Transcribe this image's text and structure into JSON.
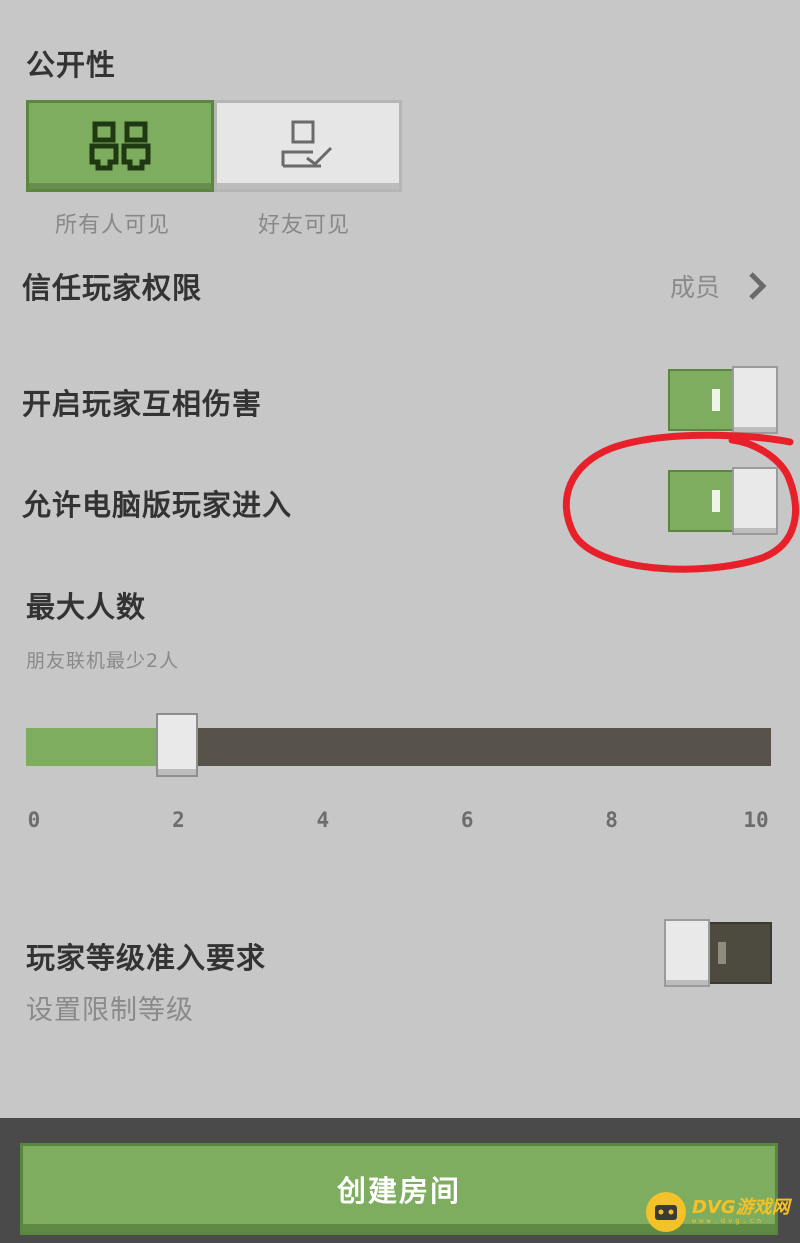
{
  "visibility": {
    "title": "公开性",
    "options": [
      {
        "label": "所有人可见",
        "icon": "all-players-icon",
        "selected": true
      },
      {
        "label": "好友可见",
        "icon": "friend-check-icon",
        "selected": false
      }
    ]
  },
  "trusted_permissions": {
    "label": "信任玩家权限",
    "value": "成员",
    "icon": "chevron-right-icon"
  },
  "pvp": {
    "label": "开启玩家互相伤害",
    "on": true
  },
  "pc_players": {
    "label": "允许电脑版玩家进入",
    "on": true
  },
  "max_players": {
    "title": "最大人数",
    "hint": "朋友联机最少2人",
    "value": 2,
    "min": 0,
    "max": 10,
    "ticks": [
      "0",
      "2",
      "4",
      "6",
      "8",
      "10"
    ]
  },
  "level_requirement": {
    "label": "玩家等级准入要求",
    "sublabel": "设置限制等级",
    "on": false
  },
  "create_button": {
    "label": "创建房间"
  },
  "watermark": {
    "text": "DVG游戏网",
    "sub": "www.dvg.cn"
  },
  "colors": {
    "accent": "#7fad5f",
    "track_dark": "#57534a",
    "background": "#c7c7c7",
    "annotation": "#e8202a"
  }
}
